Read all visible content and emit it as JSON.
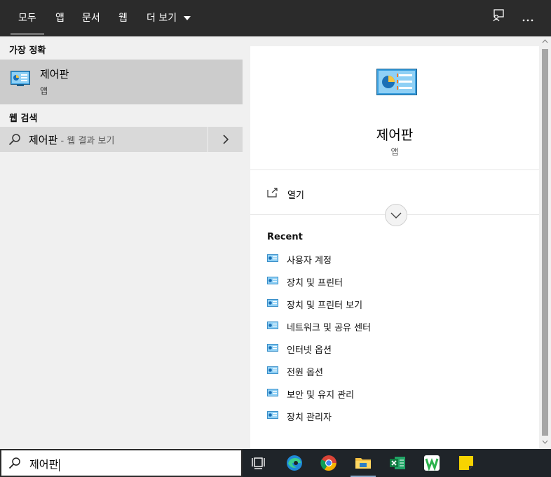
{
  "tabs": [
    {
      "label": "모두",
      "active": true
    },
    {
      "label": "앱"
    },
    {
      "label": "문서"
    },
    {
      "label": "웹"
    },
    {
      "label": "더 보기"
    }
  ],
  "topbar_icons": [
    "feedback-icon",
    "more-options-icon"
  ],
  "left": {
    "best_match_label": "가장 정확",
    "best_match": {
      "title": "제어판",
      "subtitle": "앱",
      "icon": "control-panel-icon"
    },
    "web_label": "웹 검색",
    "web_result": {
      "query": "제어판",
      "hint": " - 웹 결과 보기"
    }
  },
  "detail": {
    "title": "제어판",
    "subtitle": "앱",
    "open_label": "열기",
    "recent_title": "Recent",
    "recent_items": [
      "사용자 계정",
      "장치 및 프린터",
      "장치 및 프린터 보기",
      "네트워크 및 공유 센터",
      "인터넷 옵션",
      "전원 옵션",
      "보안 및 유지 관리",
      "장치 관리자"
    ]
  },
  "search": {
    "value": "제어판"
  },
  "taskbar_apps": [
    "task-view",
    "edge",
    "chrome",
    "file-explorer",
    "excel",
    "whale",
    "sticky-notes"
  ],
  "colors": {
    "accent_blue": "#3aa0e0",
    "topbar": "#2b2b2b",
    "selected": "#cccccc",
    "taskbar": "#1f2429"
  }
}
